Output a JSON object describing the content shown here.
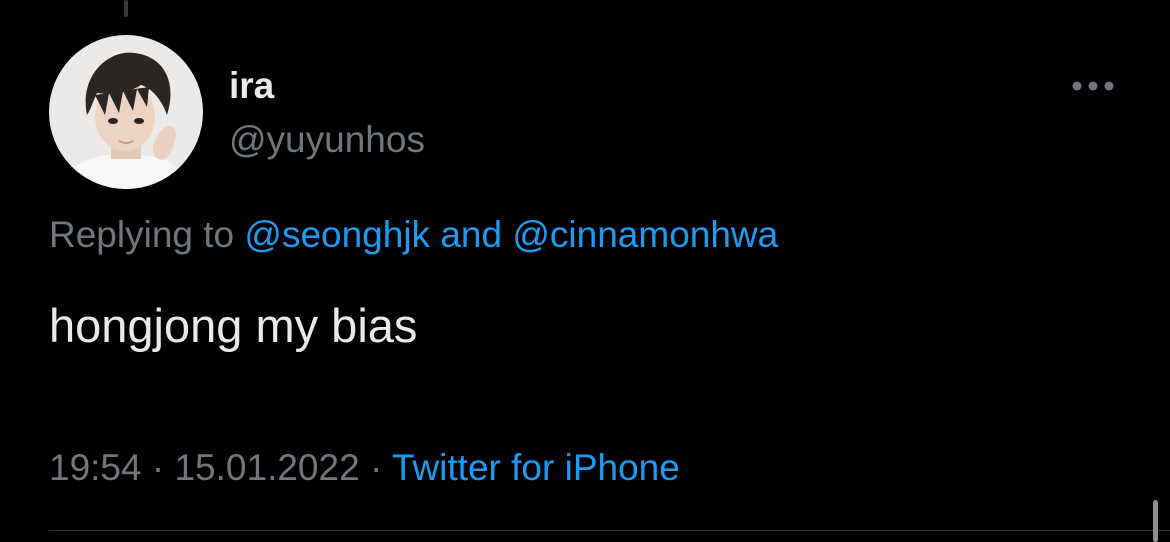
{
  "tweet": {
    "display_name": "ira",
    "handle": "@yuyunhos",
    "replying_prefix": "Replying to",
    "replying_to": [
      "@seonghjk",
      "@cinnamonhwa"
    ],
    "replying_joiner": "and",
    "text": "hongjong my bias",
    "time": "19:54",
    "separator": "·",
    "date": "15.01.2022",
    "source": "Twitter for iPhone"
  },
  "icons": {
    "more": "more-horizontal-icon",
    "avatar": "user-avatar"
  },
  "colors": {
    "background": "#000000",
    "primary_text": "#e7e9ea",
    "secondary_text": "#71767b",
    "link": "#1d9bf0",
    "divider": "#2f3336"
  }
}
